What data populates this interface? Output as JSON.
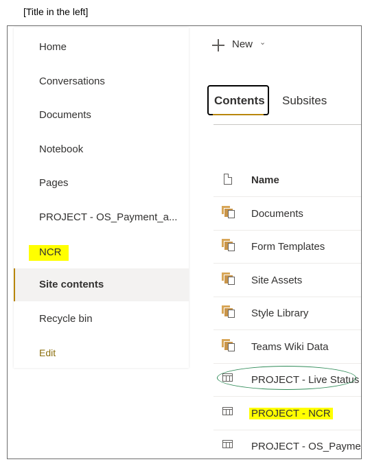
{
  "caption": "[Title in the left]",
  "nav": {
    "items": [
      {
        "label": "Home"
      },
      {
        "label": "Conversations"
      },
      {
        "label": "Documents"
      },
      {
        "label": "Notebook"
      },
      {
        "label": "Pages"
      },
      {
        "label": "PROJECT - OS_Payment_a..."
      },
      {
        "label": "NCR"
      },
      {
        "label": "Site contents"
      },
      {
        "label": "Recycle bin"
      },
      {
        "label": "Edit"
      }
    ]
  },
  "toolbar": {
    "new_label": "New"
  },
  "tabs": [
    {
      "label": "Contents"
    },
    {
      "label": "Subsites"
    }
  ],
  "list": {
    "header": {
      "name": "Name"
    },
    "rows": [
      {
        "name": "Documents",
        "icon": "document-library-icon"
      },
      {
        "name": "Form Templates",
        "icon": "document-library-icon"
      },
      {
        "name": "Site Assets",
        "icon": "document-library-icon"
      },
      {
        "name": "Style Library",
        "icon": "document-library-icon"
      },
      {
        "name": "Teams Wiki Data",
        "icon": "document-library-icon"
      },
      {
        "name": "PROJECT - Live Status",
        "icon": "list-icon"
      },
      {
        "name": "PROJECT - NCR",
        "icon": "list-icon"
      },
      {
        "name": "PROJECT - OS_Payment",
        "icon": "list-icon"
      }
    ]
  },
  "colors": {
    "highlight": "#ffff00",
    "accent": "#b8860b",
    "circle": "#2e8b57"
  }
}
